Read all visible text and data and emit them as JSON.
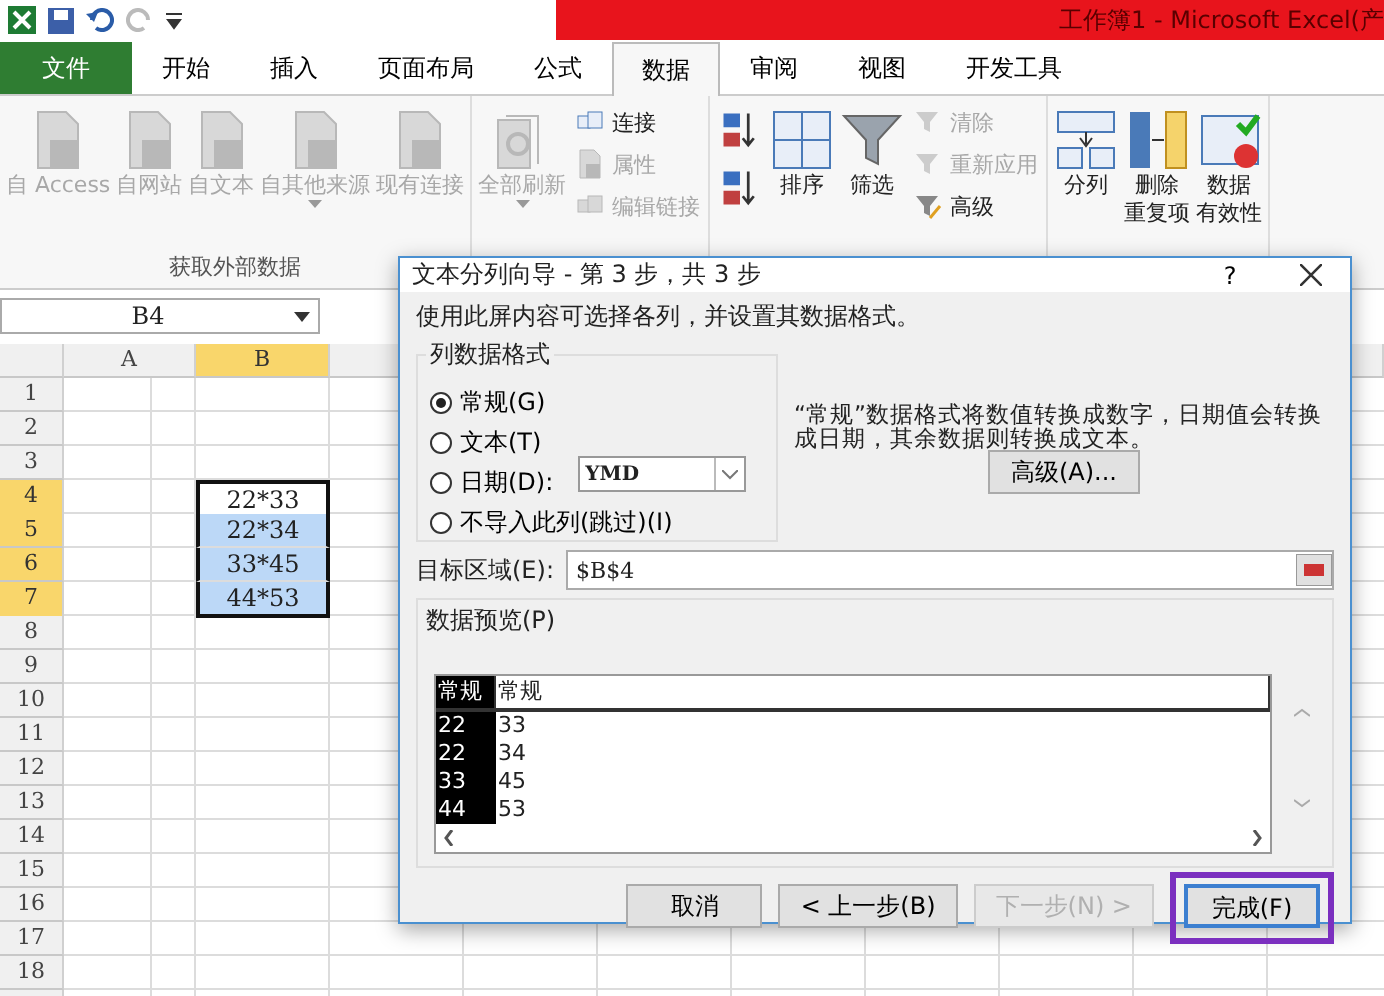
{
  "title_bar": {
    "title": "工作簿1 - Microsoft Excel(产"
  },
  "ribbon_tabs": [
    {
      "label": "文件",
      "kind": "file",
      "selected": false
    },
    {
      "label": "开始",
      "kind": "tab",
      "selected": false
    },
    {
      "label": "插入",
      "kind": "tab",
      "selected": false
    },
    {
      "label": "页面布局",
      "kind": "tab",
      "selected": false
    },
    {
      "label": "公式",
      "kind": "tab",
      "selected": false
    },
    {
      "label": "数据",
      "kind": "tab",
      "selected": true
    },
    {
      "label": "审阅",
      "kind": "tab",
      "selected": false
    },
    {
      "label": "视图",
      "kind": "tab",
      "selected": false
    },
    {
      "label": "开发工具",
      "kind": "tab",
      "selected": false
    }
  ],
  "ribbon_groups": [
    {
      "label": "获取外部数据",
      "columns": [
        [
          {
            "label": "自 Access",
            "kind": "large",
            "disabled": true
          }
        ],
        [
          {
            "label": "自网站",
            "kind": "large",
            "disabled": true
          }
        ],
        [
          {
            "label": "自文本",
            "kind": "large",
            "disabled": true
          }
        ],
        [
          {
            "label": "自其他来源",
            "kind": "large",
            "disabled": true,
            "menu": true
          }
        ],
        [
          {
            "label": "现有连接",
            "kind": "large",
            "disabled": true
          }
        ]
      ]
    },
    {
      "columns": [
        [
          {
            "label": "全部刷新",
            "kind": "large",
            "disabled": true,
            "menu": true
          }
        ],
        [
          {
            "label": "连接",
            "kind": "small",
            "disabled": false
          },
          {
            "label": "属性",
            "kind": "small",
            "disabled": true
          },
          {
            "label": "编辑链接",
            "kind": "small",
            "disabled": true
          }
        ]
      ]
    },
    {
      "columns": [
        [
          {
            "kind": "icon",
            "disabled": false
          },
          {
            "kind": "icon",
            "disabled": false
          }
        ],
        [
          {
            "label": "排序",
            "kind": "large",
            "disabled": false
          }
        ],
        [
          {
            "label": "筛选",
            "kind": "large",
            "disabled": false
          }
        ],
        [
          {
            "label": "清除",
            "kind": "small",
            "disabled": true
          },
          {
            "label": "重新应用",
            "kind": "small",
            "disabled": true
          },
          {
            "label": "高级",
            "kind": "small",
            "disabled": false
          }
        ]
      ]
    },
    {
      "columns": [
        [
          {
            "label": "分列",
            "kind": "large",
            "disabled": false
          }
        ],
        [
          {
            "lines": [
              "删除",
              "重复项"
            ],
            "kind": "large",
            "disabled": false
          }
        ],
        [
          {
            "lines": [
              "数据",
              "有效性"
            ],
            "kind": "large",
            "disabled": false
          }
        ]
      ]
    }
  ],
  "name_box": "B4",
  "sheet": {
    "columns": [
      {
        "label": "A",
        "selected": false
      },
      {
        "label": "B",
        "selected": true
      }
    ],
    "rows": [
      {
        "label": "1",
        "selected": false
      },
      {
        "label": "2",
        "selected": false
      },
      {
        "label": "3",
        "selected": false
      },
      {
        "label": "4",
        "selected": true,
        "b": {
          "value": "22*33",
          "selected": true,
          "active": true
        }
      },
      {
        "label": "5",
        "selected": true,
        "b": {
          "value": "22*34",
          "selected": true,
          "active": false
        }
      },
      {
        "label": "6",
        "selected": true,
        "b": {
          "value": "33*45",
          "selected": true,
          "active": false
        }
      },
      {
        "label": "7",
        "selected": true,
        "b": {
          "value": "44*53",
          "selected": true,
          "active": false
        }
      },
      {
        "label": "8",
        "selected": false
      },
      {
        "label": "9",
        "selected": false
      },
      {
        "label": "10",
        "selected": false
      },
      {
        "label": "11",
        "selected": false
      },
      {
        "label": "12",
        "selected": false
      },
      {
        "label": "13",
        "selected": false
      },
      {
        "label": "14",
        "selected": false
      },
      {
        "label": "15",
        "selected": false
      },
      {
        "label": "16",
        "selected": false
      },
      {
        "label": "17",
        "selected": false
      },
      {
        "label": "18",
        "selected": false
      }
    ]
  },
  "dialog": {
    "title": "文本分列向导 - 第 3 步，共 3 步",
    "help": "?",
    "instruction": "使用此屏内容可选择各列，并设置其数据格式。",
    "format_group": {
      "label": "列数据格式",
      "options": [
        {
          "label": "常规(G)",
          "selected": true
        },
        {
          "label": "文本(T)",
          "selected": false
        },
        {
          "label": "日期(D):",
          "selected": false,
          "combo": "YMD"
        },
        {
          "label": "不导入此列(跳过)(I)",
          "selected": false
        }
      ]
    },
    "description": "“常规”数据格式将数值转换成数字，日期值会转换成日期，其余数据则转换成文本。",
    "advanced_button": "高级(A)...",
    "destination": {
      "label": "目标区域(E):",
      "value": "$B$4"
    },
    "preview": {
      "label": "数据预览(P)",
      "columns": [
        {
          "header": "常规",
          "selected": true,
          "values": [
            "22",
            "22",
            "33",
            "44"
          ]
        },
        {
          "header": "常规",
          "selected": false,
          "values": [
            "33",
            "34",
            "45",
            "53"
          ]
        }
      ]
    },
    "buttons": [
      {
        "label": "取消",
        "disabled": false,
        "default": false,
        "highlighted": false
      },
      {
        "label": "< 上一步(B)",
        "disabled": false,
        "default": false,
        "highlighted": false
      },
      {
        "label": "下一步(N) >",
        "disabled": true,
        "default": false,
        "highlighted": false
      },
      {
        "label": "完成(F)",
        "disabled": false,
        "default": true,
        "highlighted": true
      }
    ]
  }
}
